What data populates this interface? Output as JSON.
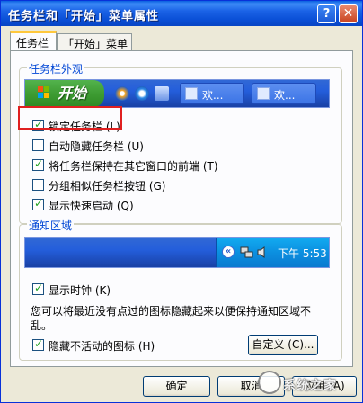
{
  "window": {
    "title": "任务栏和「开始」菜单属性",
    "help_glyph": "?",
    "close_glyph": "✕"
  },
  "tabs": [
    {
      "label": "任务栏",
      "active": true
    },
    {
      "label": "「开始」菜单",
      "active": false
    }
  ],
  "appearance": {
    "legend": "任务栏外观",
    "preview": {
      "start_label": "开始",
      "task_buttons": [
        "欢...",
        "欢..."
      ]
    },
    "options": [
      {
        "label": "锁定任务栏 (L)",
        "checked": true
      },
      {
        "label": "自动隐藏任务栏 (U)",
        "checked": false
      },
      {
        "label": "将任务栏保持在其它窗口的前端 (T)",
        "checked": true
      },
      {
        "label": "分组相似任务栏按钮 (G)",
        "checked": false
      },
      {
        "label": "显示快速启动 (Q)",
        "checked": true
      }
    ]
  },
  "notification": {
    "legend": "通知区域",
    "clock_text": "下午 5:53",
    "show_clock": {
      "label": "显示时钟 (K)",
      "checked": true
    },
    "description": "您可以将最近没有点过的图标隐藏起来以便保持通知区域不乱。",
    "hide_inactive": {
      "label": "隐藏不活动的图标 (H)",
      "checked": true
    },
    "customize_label": "自定义 (C)..."
  },
  "buttons": {
    "ok": "确定",
    "cancel": "取消",
    "apply": "应用 (A)"
  },
  "watermark": {
    "text": "系统之家"
  },
  "colors": {
    "titlebar": "#0a4fd6",
    "highlight_box": "#e02020",
    "legend_text": "#0046d5"
  }
}
